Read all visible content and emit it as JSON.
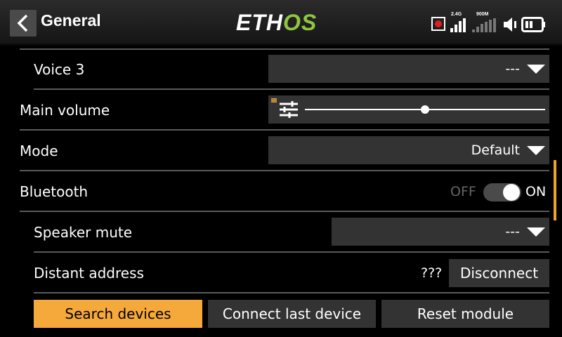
{
  "header": {
    "title": "General",
    "logo_prefix": "ETH",
    "logo_suffix": "OS",
    "signal_24g_label": "2.4G",
    "signal_900m_label": "900M",
    "back_icon": "chevron-left-icon",
    "record_icon": "record-icon",
    "speaker_icon": "speaker-icon",
    "battery_icon": "battery-icon"
  },
  "rows": {
    "voice3": {
      "label": "Voice 3",
      "value": "---"
    },
    "main_volume": {
      "label": "Main volume",
      "volume_level": 0.5,
      "icon": "sliders-icon"
    },
    "mode": {
      "label": "Mode",
      "value": "Default"
    },
    "bluetooth": {
      "label": "Bluetooth",
      "off_label": "OFF",
      "on_label": "ON",
      "state": "on"
    },
    "speaker_mute": {
      "label": "Speaker mute",
      "value": "---"
    },
    "distant_address": {
      "label": "Distant address",
      "value": "???",
      "button": "Disconnect"
    }
  },
  "buttons": {
    "search": "Search devices",
    "connect_last": "Connect last device",
    "reset": "Reset module"
  },
  "colors": {
    "accent": "#f6a93b",
    "logo_green": "#8fc63f",
    "record_red": "#e01b24"
  }
}
